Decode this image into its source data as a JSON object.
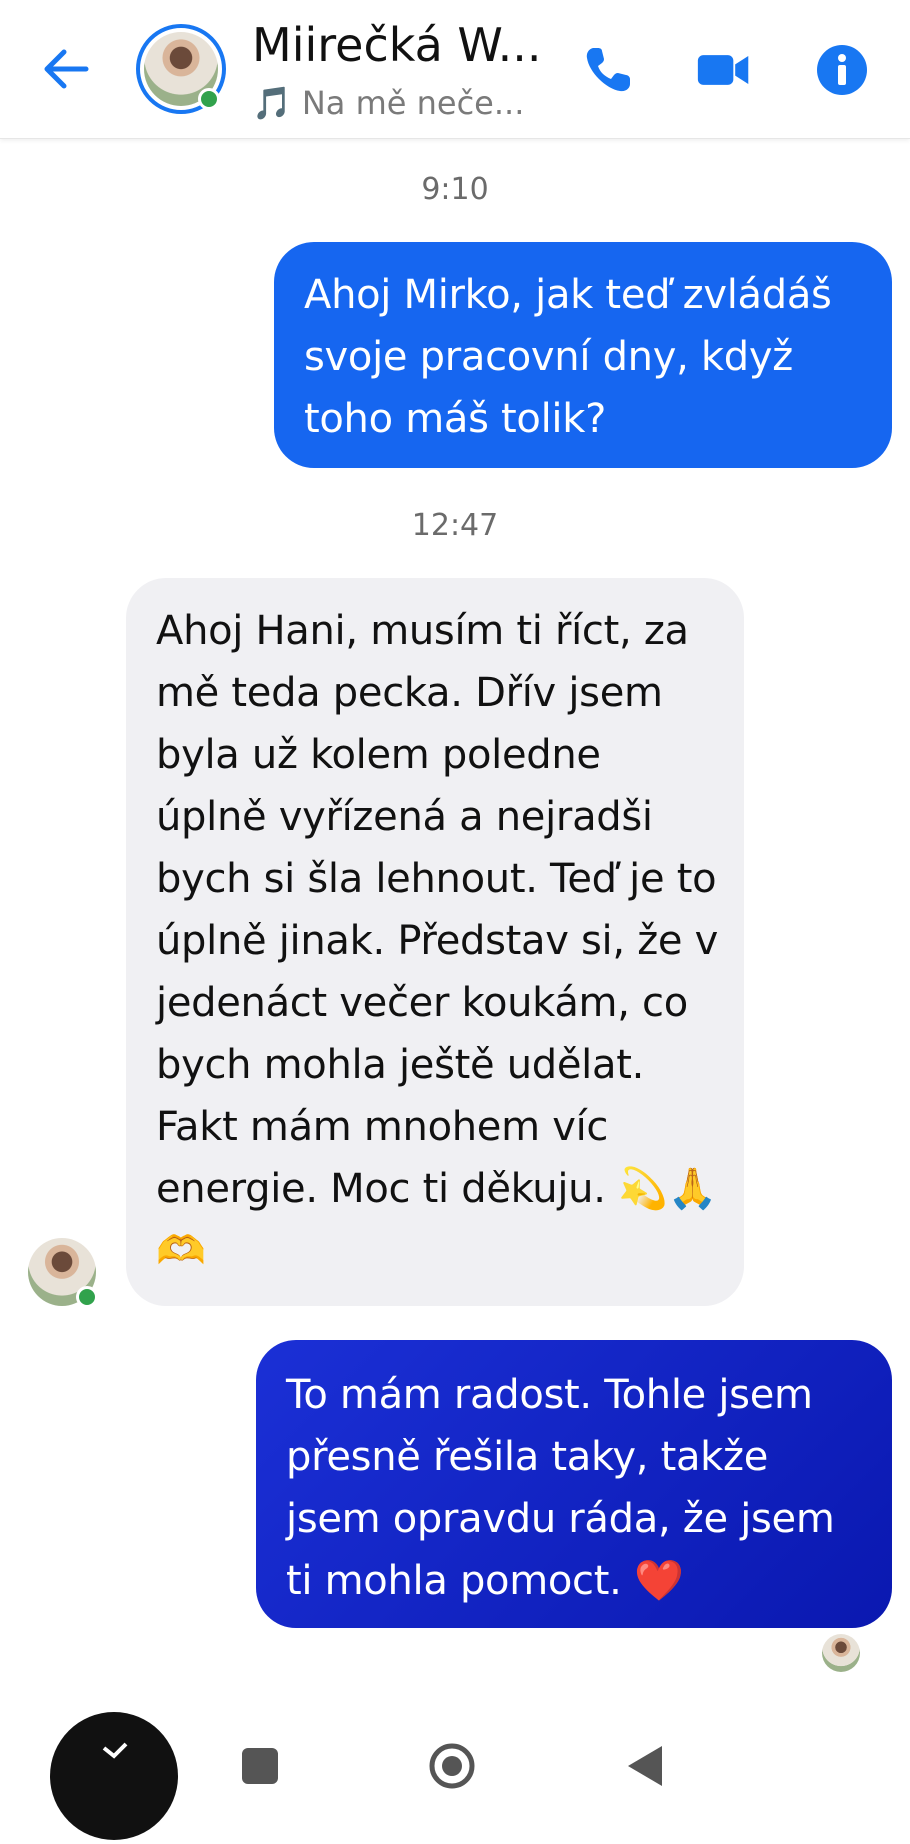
{
  "header": {
    "back_icon": "arrow-left-icon",
    "contact_name": "Miirečká W...",
    "status_prefix": "🎵",
    "status_text": "Na mě neče...",
    "icons": [
      "phone-icon",
      "video-camera-icon",
      "info-icon"
    ],
    "accent_color": "#1877f2",
    "online_color": "#31a24c"
  },
  "messages": [
    {
      "type": "timestamp",
      "text": "9:10"
    },
    {
      "type": "outgoing",
      "text": "Ahoj Mirko, jak teď zvládáš svoje pracovní dny, když toho máš tolik?"
    },
    {
      "type": "timestamp",
      "text": "12:47"
    },
    {
      "type": "incoming",
      "text": "Ahoj Hani, musím ti říct, za mě teda pecka. Dřív jsem byla už kolem poledne úplně vyřízená a nejradši bych si šla lehnout. Teď je to úplně jinak. Představ si, že v jedenáct večer koukám, co bych mohla ještě udělat. Fakt mám mnohem víc energie. Moc ti děkuju. 💫🙏🫶"
    },
    {
      "type": "outgoing",
      "text": "To mám radost. Tohle jsem přesně řešila taky, takže jsem opravdu ráda, že jsem ti mohla pomoct. ❤️"
    }
  ],
  "colors": {
    "outgoing_bubble": "#1666f0",
    "outgoing_bubble_dark": "#0a18b0",
    "incoming_bubble": "#f0f0f3"
  },
  "nav": {
    "icons": [
      "recent-apps-icon",
      "home-icon",
      "back-triangle-icon"
    ]
  }
}
